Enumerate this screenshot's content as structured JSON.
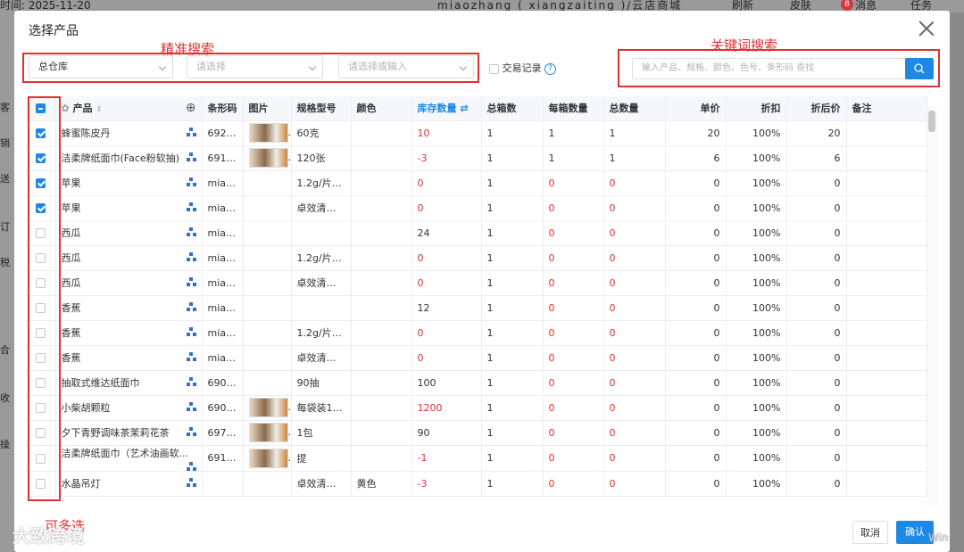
{
  "background": {
    "date_text": "时间: 2025-11-20",
    "store_text": "miaozhang ( xiangzaiting )/云店商城",
    "refresh": "刷新",
    "skin": "皮肤",
    "messages": "消息",
    "message_count": "8",
    "tasks": "任务",
    "side_labels": [
      "客",
      "销",
      "送",
      "订",
      "税",
      "合",
      "收",
      "操"
    ]
  },
  "dialog": {
    "title": "选择产品",
    "warehouse": "总仓库",
    "select2_placeholder": "请选择",
    "select3_placeholder": "请选择或输入",
    "trade_record_label": "交易记录",
    "help_icon": "?",
    "search_placeholder": "输入产品、规格、颜色、色号、条形码 查找",
    "cancel": "取消",
    "confirm": "确认"
  },
  "annotations": {
    "exact_search": "精准搜索",
    "keyword_search": "关键词搜索",
    "multi_select": "可多选"
  },
  "watermark": "大致跨境",
  "watermark2": "Win",
  "table": {
    "headers": [
      "产品",
      "条形码",
      "图片",
      "规格型号",
      "颜色",
      "库存数量",
      "总箱数",
      "每箱数量",
      "总数量",
      "单价",
      "折扣",
      "折后价",
      "备注"
    ],
    "rows": [
      {
        "checked": true,
        "product": "蜂蜜陈皮丹",
        "barcode": "6928...",
        "image": true,
        "spec": "60克",
        "color": "",
        "stock": "10",
        "stock_red": true,
        "boxes": "1",
        "per_box": "1",
        "per_box_red": false,
        "total": "1",
        "total_red": false,
        "price": "20",
        "discount": "100%",
        "final": "20"
      },
      {
        "checked": true,
        "product": "洁柔牌纸面巾(Face粉软抽)",
        "barcode": "6914...",
        "image": true,
        "spec": "120张",
        "color": "",
        "stock": "-3",
        "stock_red": true,
        "boxes": "1",
        "per_box": "1",
        "per_box_red": false,
        "total": "1",
        "total_red": false,
        "price": "6",
        "discount": "100%",
        "final": "6"
      },
      {
        "checked": true,
        "product": "苹果",
        "barcode": "miao...",
        "image": false,
        "spec": "1.2g/片*...",
        "color": "",
        "stock": "0",
        "stock_red": true,
        "boxes": "1",
        "per_box": "0",
        "per_box_red": true,
        "total": "0",
        "total_red": true,
        "price": "0",
        "discount": "100%",
        "final": "0"
      },
      {
        "checked": true,
        "product": "苹果",
        "barcode": "miao...",
        "image": false,
        "spec": "卓效清新...",
        "color": "",
        "stock": "0",
        "stock_red": true,
        "boxes": "1",
        "per_box": "0",
        "per_box_red": true,
        "total": "0",
        "total_red": true,
        "price": "0",
        "discount": "100%",
        "final": "0"
      },
      {
        "checked": false,
        "product": "西瓜",
        "barcode": "miao...",
        "image": false,
        "spec": "",
        "color": "",
        "stock": "24",
        "stock_red": false,
        "boxes": "1",
        "per_box": "0",
        "per_box_red": true,
        "total": "0",
        "total_red": true,
        "price": "0",
        "discount": "100%",
        "final": "0"
      },
      {
        "checked": false,
        "product": "西瓜",
        "barcode": "miao...",
        "image": false,
        "spec": "1.2g/片*...",
        "color": "",
        "stock": "0",
        "stock_red": true,
        "boxes": "1",
        "per_box": "0",
        "per_box_red": true,
        "total": "0",
        "total_red": true,
        "price": "0",
        "discount": "100%",
        "final": "0"
      },
      {
        "checked": false,
        "product": "西瓜",
        "barcode": "miao...",
        "image": false,
        "spec": "卓效清新...",
        "color": "",
        "stock": "0",
        "stock_red": true,
        "boxes": "1",
        "per_box": "0",
        "per_box_red": true,
        "total": "0",
        "total_red": true,
        "price": "0",
        "discount": "100%",
        "final": "0"
      },
      {
        "checked": false,
        "product": "香蕉",
        "barcode": "miao...",
        "image": false,
        "spec": "",
        "color": "",
        "stock": "12",
        "stock_red": false,
        "boxes": "1",
        "per_box": "0",
        "per_box_red": true,
        "total": "0",
        "total_red": true,
        "price": "0",
        "discount": "100%",
        "final": "0"
      },
      {
        "checked": false,
        "product": "香蕉",
        "barcode": "miao...",
        "image": false,
        "spec": "1.2g/片*...",
        "color": "",
        "stock": "0",
        "stock_red": true,
        "boxes": "1",
        "per_box": "0",
        "per_box_red": true,
        "total": "0",
        "total_red": true,
        "price": "0",
        "discount": "100%",
        "final": "0"
      },
      {
        "checked": false,
        "product": "香蕉",
        "barcode": "miao...",
        "image": false,
        "spec": "卓效清新...",
        "color": "",
        "stock": "0",
        "stock_red": true,
        "boxes": "1",
        "per_box": "0",
        "per_box_red": true,
        "total": "0",
        "total_red": true,
        "price": "0",
        "discount": "100%",
        "final": "0"
      },
      {
        "checked": false,
        "product": "抽取式维达纸面巾",
        "barcode": "6901...",
        "image": false,
        "spec": "90抽",
        "color": "",
        "stock": "100",
        "stock_red": false,
        "boxes": "1",
        "per_box": "0",
        "per_box_red": true,
        "total": "0",
        "total_red": true,
        "price": "0",
        "discount": "100%",
        "final": "0"
      },
      {
        "checked": false,
        "product": "小柴胡颗粒",
        "barcode": "6900...",
        "image": true,
        "spec": "每袋装10...",
        "color": "",
        "stock": "1200",
        "stock_red": true,
        "boxes": "1",
        "per_box": "0",
        "per_box_red": true,
        "total": "0",
        "total_red": true,
        "price": "0",
        "discount": "100%",
        "final": "0"
      },
      {
        "checked": false,
        "product": "夕下青野调味茶茉莉花茶",
        "barcode": "6970...",
        "image": true,
        "spec": "1包",
        "color": "",
        "stock": "90",
        "stock_red": false,
        "boxes": "1",
        "per_box": "0",
        "per_box_red": true,
        "total": "0",
        "total_red": true,
        "price": "0",
        "discount": "100%",
        "final": "0"
      },
      {
        "checked": false,
        "product": "洁柔牌纸面巾（艺术油画软...",
        "barcode": "6914...",
        "image": true,
        "spec": "提",
        "color": "",
        "stock": "-1",
        "stock_red": true,
        "boxes": "1",
        "per_box": "0",
        "per_box_red": true,
        "total": "0",
        "total_red": true,
        "price": "0",
        "discount": "100%",
        "final": "0"
      },
      {
        "checked": false,
        "product": "水晶吊灯",
        "barcode": "",
        "image": false,
        "spec": "卓效清新...",
        "color": "黄色",
        "stock": "-3",
        "stock_red": true,
        "boxes": "1",
        "per_box": "0",
        "per_box_red": true,
        "total": "0",
        "total_red": true,
        "price": "0",
        "discount": "100%",
        "final": "0"
      }
    ]
  }
}
